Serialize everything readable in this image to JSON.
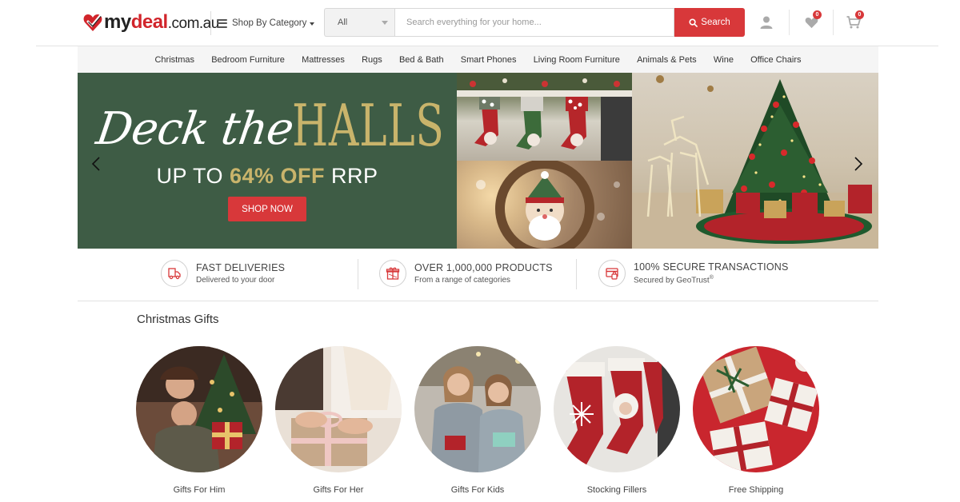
{
  "header": {
    "logo": {
      "part1": "my",
      "part2": "deal",
      "part3": ".com.au"
    },
    "shop_by_category": "Shop By Category",
    "search": {
      "category_selected": "All",
      "placeholder": "Search everything for your home...",
      "button_label": "Search"
    },
    "wishlist_count": "0",
    "cart_count": "0"
  },
  "nav": {
    "items": [
      "Christmas",
      "Bedroom Furniture",
      "Mattresses",
      "Rugs",
      "Bed & Bath",
      "Smart Phones",
      "Living Room Furniture",
      "Animals & Pets",
      "Wine",
      "Office Chairs"
    ]
  },
  "banner": {
    "script_text": "Deck the",
    "headline": "HALLS",
    "offer_prefix": "UP TO ",
    "offer_pct": "64% OFF",
    "offer_suffix": " RRP",
    "cta": "SHOP NOW"
  },
  "features": [
    {
      "title": "FAST DELIVERIES",
      "subtitle": "Delivered to your door"
    },
    {
      "title": "OVER 1,000,000 PRODUCTS",
      "subtitle": "From a range of categories"
    },
    {
      "title": "100% SECURE TRANSACTIONS",
      "subtitle": "Secured by GeoTrust",
      "subtitle_sup": "®"
    }
  ],
  "gifts": {
    "title": "Christmas Gifts",
    "items": [
      {
        "label": "Gifts For Him"
      },
      {
        "label": "Gifts For Her"
      },
      {
        "label": "Gifts For Kids"
      },
      {
        "label": "Stocking Fillers"
      },
      {
        "label": "Free Shipping"
      }
    ]
  },
  "colors": {
    "brand_red": "#d8383a",
    "banner_green": "#3e5c45",
    "banner_gold": "#c9b46b"
  }
}
